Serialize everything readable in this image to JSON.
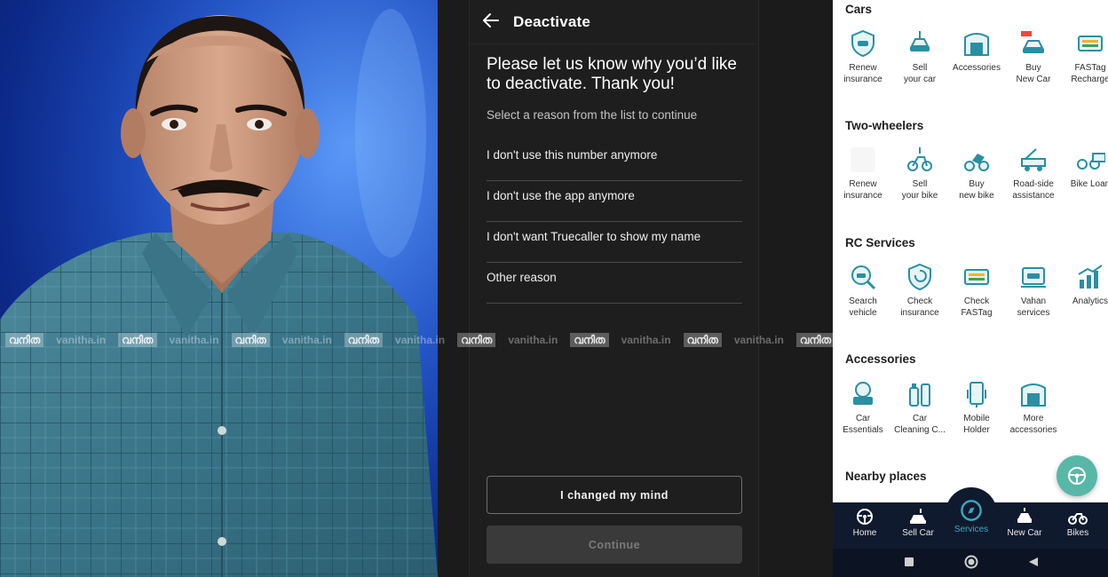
{
  "deactivate": {
    "title": "Deactivate",
    "prompt": "Please let us know why you’d like to deactivate. Thank you!",
    "subtitle": "Select a reason from the list to continue",
    "reasons": [
      "I don't use this number anymore",
      "I don't use the app anymore",
      "I don't want Truecaller to show my name",
      "Other reason"
    ],
    "changed_mind_label": "I changed my mind",
    "continue_label": "Continue"
  },
  "app": {
    "sections": [
      {
        "title": "Cars",
        "items": [
          {
            "label": "Renew\ninsurance",
            "icon": "shield-car-icon"
          },
          {
            "label": "Sell\nyour car",
            "icon": "sell-car-icon"
          },
          {
            "label": "Accessories",
            "icon": "carinfo-store-icon"
          },
          {
            "label": "Buy\nNew Car",
            "icon": "new-car-icon"
          },
          {
            "label": "FASTag\nRecharge",
            "icon": "fastag-card-icon"
          }
        ]
      },
      {
        "title": "Two-wheelers",
        "items": [
          {
            "label": "Renew\ninsurance",
            "icon": "blank-icon"
          },
          {
            "label": "Sell\nyour bike",
            "icon": "sell-bike-icon"
          },
          {
            "label": "Buy\nnew bike",
            "icon": "new-bike-icon"
          },
          {
            "label": "Road-side\nassistance",
            "icon": "tow-truck-icon"
          },
          {
            "label": "Bike Loan",
            "icon": "bike-loan-icon"
          }
        ]
      },
      {
        "title": "RC Services",
        "items": [
          {
            "label": "Search\nvehicle",
            "icon": "search-vehicle-icon"
          },
          {
            "label": "Check\ninsurance",
            "icon": "check-insurance-icon"
          },
          {
            "label": "Check\nFASTag",
            "icon": "fastag-card-icon"
          },
          {
            "label": "Vahan\nservices",
            "icon": "vahan-icon"
          },
          {
            "label": "Analytics",
            "icon": "analytics-icon"
          }
        ]
      },
      {
        "title": "Accessories",
        "items": [
          {
            "label": "Car\nEssentials",
            "icon": "car-essentials-icon"
          },
          {
            "label": "Car\nCleaning C...",
            "icon": "cleaning-icon"
          },
          {
            "label": "Mobile\nHolder",
            "icon": "mobile-holder-icon"
          },
          {
            "label": "More\naccessories",
            "icon": "carinfo-store-icon"
          }
        ]
      },
      {
        "title": "Nearby places",
        "items": []
      }
    ],
    "bottom_nav": [
      {
        "label": "Home",
        "icon": "steering-wheel-icon",
        "active": false
      },
      {
        "label": "Sell Car",
        "icon": "sell-car-icon",
        "active": false
      },
      {
        "label": "Services",
        "icon": "compass-icon",
        "active": true
      },
      {
        "label": "New Car",
        "icon": "new-car-icon",
        "active": false
      },
      {
        "label": "Bikes",
        "icon": "bike-icon",
        "active": false
      }
    ],
    "accent": "#3ba9bd",
    "icon_color": "#2a8fa3"
  },
  "watermark": [
    "vanitha.in",
    "വനിത"
  ]
}
